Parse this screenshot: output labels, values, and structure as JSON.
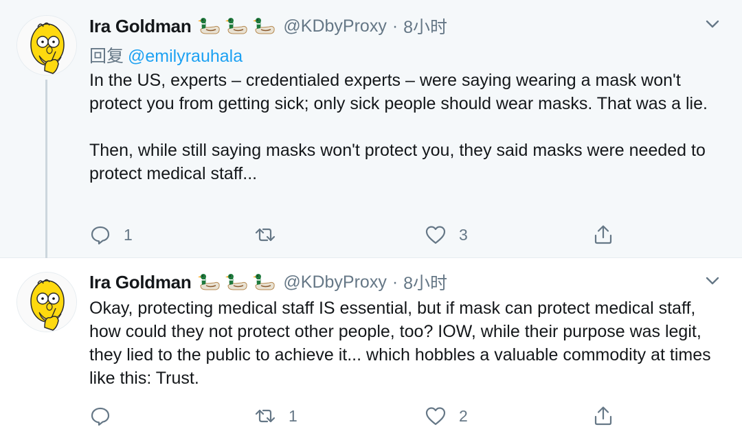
{
  "tweets": [
    {
      "author": "Ira Goldman",
      "emoji": [
        "duck-emoji",
        "duck-emoji",
        "duck-emoji"
      ],
      "handle": "@KDbyProxy",
      "separator": "·",
      "time": "8小时",
      "replying_prefix": "回复",
      "replying_to": "@emilyrauhala",
      "paragraphs": [
        "In the US, experts – credentialed experts – were saying wearing a mask won't protect you from getting sick; only sick people should wear masks. That was a lie.",
        "Then, while still saying masks won't protect you, they said masks were needed to protect medical staff..."
      ],
      "reply_count": "1",
      "retweet_count": "",
      "like_count": "3"
    },
    {
      "author": "Ira Goldman",
      "emoji": [
        "duck-emoji",
        "duck-emoji",
        "duck-emoji"
      ],
      "handle": "@KDbyProxy",
      "separator": "·",
      "time": "8小时",
      "paragraphs": [
        "Okay, protecting medical staff IS essential, but if mask can protect medical staff, how could they not protect other people, too? IOW, while their purpose was legit, they lied to the public to achieve it... which hobbles a valuable commodity at times like this: Trust."
      ],
      "reply_count": "",
      "retweet_count": "1",
      "like_count": "2"
    }
  ],
  "colors": {
    "highlight_bg": "#f5f8fa",
    "text": "#14171a",
    "secondary": "#657786",
    "link": "#1da1f2",
    "thread_line": "#ccd6dd"
  }
}
